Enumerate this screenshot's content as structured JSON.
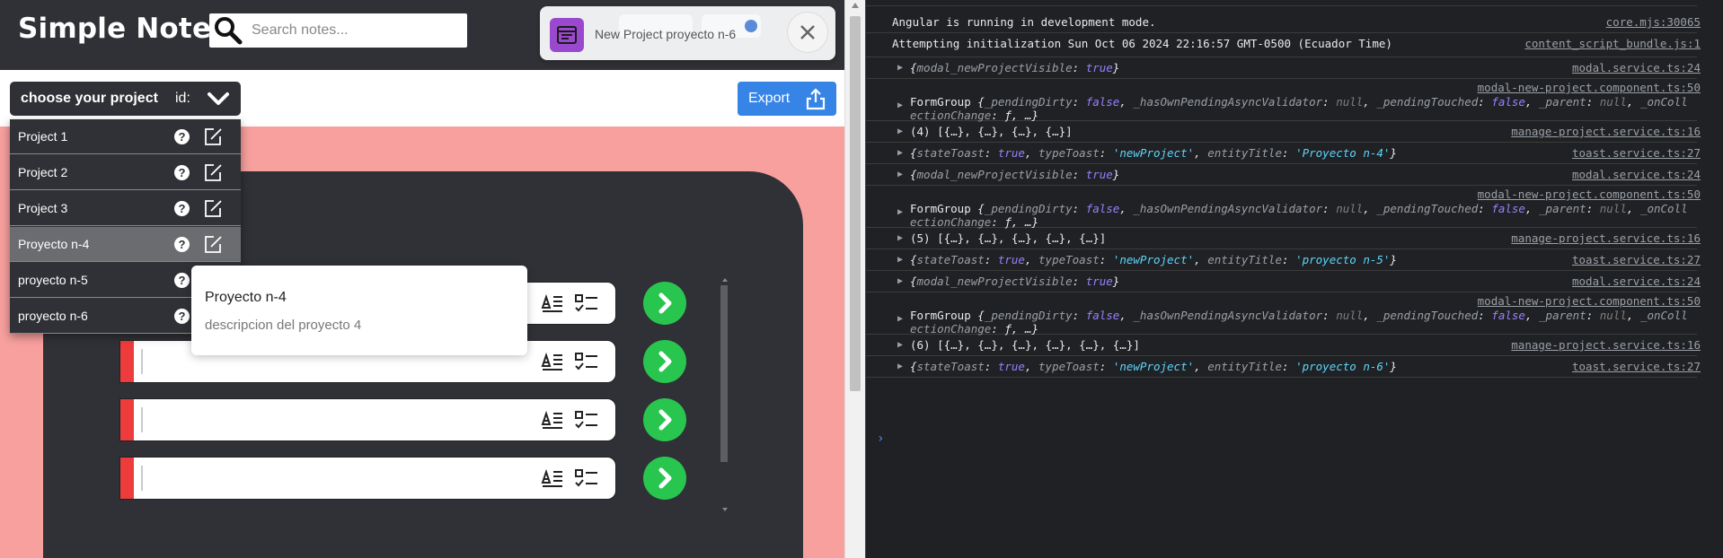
{
  "app": {
    "brand": "Simple Notes",
    "search_placeholder": "Search notes...",
    "toast": {
      "message": "New Project proyecto n-6",
      "accent": "#9a49cf"
    },
    "project_selector": {
      "label": "choose your project",
      "id_label": "id:"
    },
    "export_label": "Export",
    "projects": [
      {
        "name": "Project 1",
        "active": false
      },
      {
        "name": "Project 2",
        "active": false
      },
      {
        "name": "Project 3",
        "active": false
      },
      {
        "name": "Proyecto n-4",
        "active": true
      },
      {
        "name": "proyecto n-5",
        "active": false
      },
      {
        "name": "proyecto n-6",
        "active": false
      }
    ],
    "tooltip": {
      "title": "Proyecto n-4",
      "description": "descripcion del proyecto 4"
    },
    "colors": {
      "header": "#303136",
      "pink": "#f8a09e",
      "note_marker": "#ee3c3d",
      "go": "#28c64f",
      "export": "#3684e6"
    }
  },
  "console": {
    "rows": [
      {
        "kind": "text",
        "message": "Angular is running in development mode.",
        "source": "core.mjs:30065"
      },
      {
        "kind": "text",
        "message": "Attempting initialization Sun Oct 06 2024 22:16:57 GMT-0500 (Ecuador Time)",
        "source": "content_script_bundle.js:1"
      },
      {
        "kind": "modal",
        "source": "modal.service.ts:24"
      },
      {
        "kind": "form",
        "source": "modal-new-project.component.ts:50"
      },
      {
        "kind": "array",
        "count": "(4)",
        "items": "[{…}, {…}, {…}, {…}]",
        "source": "manage-project.service.ts:16"
      },
      {
        "kind": "toast",
        "entity": "'Proyecto n-4'",
        "source": "toast.service.ts:27"
      },
      {
        "kind": "modal",
        "source": "modal.service.ts:24"
      },
      {
        "kind": "form",
        "source": "modal-new-project.component.ts:50"
      },
      {
        "kind": "array",
        "count": "(5)",
        "items": "[{…}, {…}, {…}, {…}, {…}]",
        "source": "manage-project.service.ts:16"
      },
      {
        "kind": "toast",
        "entity": "'proyecto n-5'",
        "source": "toast.service.ts:27"
      },
      {
        "kind": "modal",
        "source": "modal.service.ts:24"
      },
      {
        "kind": "form",
        "source": "modal-new-project.component.ts:50"
      },
      {
        "kind": "array",
        "count": "(6)",
        "items": "[{…}, {…}, {…}, {…}, {…}, {…}]",
        "source": "manage-project.service.ts:16"
      },
      {
        "kind": "toast",
        "entity": "'proyecto n-6'",
        "source": "toast.service.ts:27"
      }
    ],
    "tokens": {
      "modal_key": "modal_newProjectVisible",
      "true": "true",
      "false": "false",
      "null": "null",
      "formgroup": "FormGroup",
      "pending_dirty": "_pendingDirty",
      "has_pending": "_hasOwnPendingAsyncValidator",
      "pending_touched": "_pendingTouched",
      "parent": "_parent",
      "on_collection": "_onColl",
      "ection_change": "ectionChange",
      "f_ellipsis": "ƒ, …}",
      "state_toast": "stateToast",
      "type_toast": "typeToast",
      "new_project": "'newProject'",
      "entity_title": "entityTitle"
    }
  }
}
